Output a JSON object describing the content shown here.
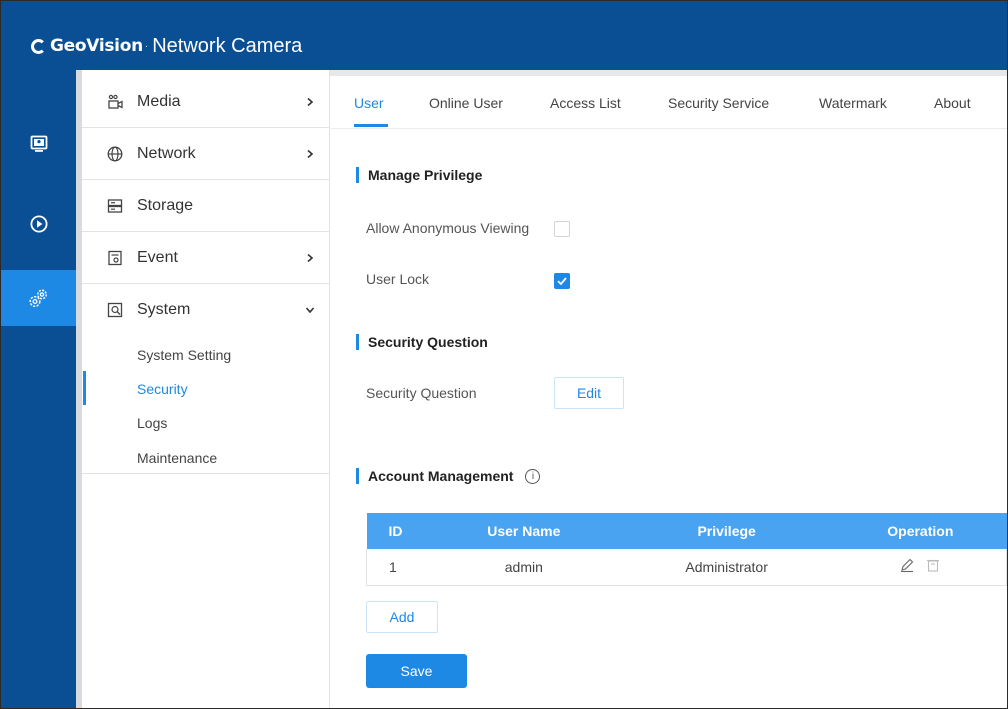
{
  "header": {
    "brand_logo_text": "GeoVision",
    "brand_separator": "·",
    "app_title": "Network Camera"
  },
  "rail": {
    "items": [
      {
        "icon": "monitor-icon",
        "active": false
      },
      {
        "icon": "playback-icon",
        "active": false
      },
      {
        "icon": "settings-gears-icon",
        "active": true
      }
    ]
  },
  "sidebar": {
    "items": [
      {
        "label": "Media",
        "icon": "camera-icon",
        "arrow": "›"
      },
      {
        "label": "Network",
        "icon": "globe-icon",
        "arrow": "›"
      },
      {
        "label": "Storage",
        "icon": "storage-icon"
      },
      {
        "label": "Event",
        "icon": "event-icon",
        "arrow": "›"
      },
      {
        "label": "System",
        "icon": "system-icon",
        "arrow": "⌄"
      }
    ],
    "sub_items": [
      {
        "label": "System Setting"
      },
      {
        "label": "Security",
        "active": true
      },
      {
        "label": "Logs"
      },
      {
        "label": "Maintenance"
      }
    ]
  },
  "tabs": [
    {
      "label": "User",
      "active": true
    },
    {
      "label": "Online User"
    },
    {
      "label": "Access List"
    },
    {
      "label": "Security Service"
    },
    {
      "label": "Watermark"
    },
    {
      "label": "About"
    }
  ],
  "manage_privilege": {
    "title": "Manage Privilege",
    "anonymous_label": "Allow Anonymous Viewing",
    "anonymous_checked": false,
    "user_lock_label": "User Lock",
    "user_lock_checked": true
  },
  "security_question": {
    "title": "Security Question",
    "field_label": "Security Question",
    "edit_label": "Edit"
  },
  "account_management": {
    "title": "Account Management",
    "info_glyph": "i",
    "columns": [
      "ID",
      "User Name",
      "Privilege",
      "Operation"
    ],
    "rows": [
      {
        "id": "1",
        "user_name": "admin",
        "privilege": "Administrator"
      }
    ],
    "add_label": "Add",
    "save_label": "Save"
  },
  "colors": {
    "header_bg": "#0a4f94",
    "accent": "#1e88e5",
    "table_header": "#4aa3f0"
  }
}
